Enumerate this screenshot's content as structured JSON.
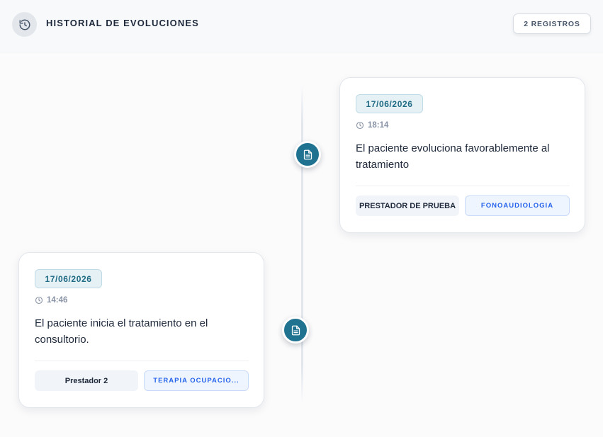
{
  "header": {
    "title": "HISTORIAL DE EVOLUCIONES",
    "icon": "history-icon",
    "count_label": "2 REGISTROS"
  },
  "entries": [
    {
      "date": "17/06/2026",
      "time": "18:14",
      "description": "El paciente evoluciona favorablemente al tratamiento",
      "provider": "PRESTADOR DE PRUEBA",
      "specialty": "FONOAUDIOLOGIA",
      "node_icon": "document-icon"
    },
    {
      "date": "17/06/2026",
      "time": "14:46",
      "description": "El paciente inicia el tratamiento en el consultorio.",
      "provider": "Prestador 2",
      "specialty": "TERAPIA OCUPACIO...",
      "node_icon": "document-icon"
    }
  ],
  "colors": {
    "accent": "#1f7390",
    "specialty_text": "#2563eb",
    "date_text": "#1f6b85"
  }
}
